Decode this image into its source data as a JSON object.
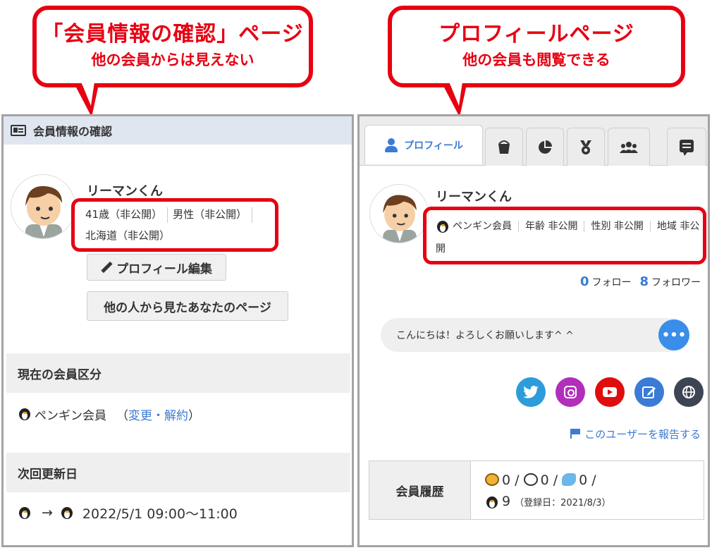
{
  "callouts": {
    "left": {
      "title": "「会員情報の確認」ページ",
      "subtitle": "他の会員からは見えない"
    },
    "right": {
      "title": "プロフィールページ",
      "subtitle": "他の会員も閲覧できる"
    }
  },
  "left_panel": {
    "header": "会員情報の確認",
    "name": "リーマンくん",
    "info": {
      "age": "41歳（非公開）",
      "gender": "男性（非公開）",
      "region": "北海道（非公開）"
    },
    "edit_button": "プロフィール編集",
    "view_button": "他の人から見たあなたのページ",
    "membership_heading": "現在の会員区分",
    "membership_value": "ペンギン会員",
    "membership_link_open": "（",
    "membership_link": "変更・解約",
    "membership_link_close": "）",
    "renewal_heading": "次回更新日",
    "renewal_arrow": "→",
    "renewal_value": "2022/5/1  09:00〜11:00"
  },
  "right_panel": {
    "active_tab": "プロフィール",
    "tabs_icons": [
      "bucket-icon",
      "pie-chart-icon",
      "medal-icon",
      "group-icon",
      "comment-icon"
    ],
    "name": "リーマンくん",
    "info": {
      "membership": "ペンギン会員",
      "age": "年齢 非公開",
      "gender": "性別 非公開",
      "region": "地域 非公開"
    },
    "follow_count": "0",
    "follow_label": "フォロー",
    "follower_count": "8",
    "follower_label": "フォロワー",
    "greeting": "こんにちは！よろしくお願いします^ ^",
    "more_label": "•••",
    "report_link": "このユーザーを報告する",
    "history_heading": "会員履歴",
    "history_line1": "0 /",
    "history_line1b": "0 /",
    "history_line1c": "0 /",
    "history_count": "9",
    "history_registered": "（登録日：2021/8/3）"
  },
  "colors": {
    "accent_red": "#e60012",
    "link_blue": "#3a7bd5",
    "header_bg": "#dfe6f0"
  }
}
